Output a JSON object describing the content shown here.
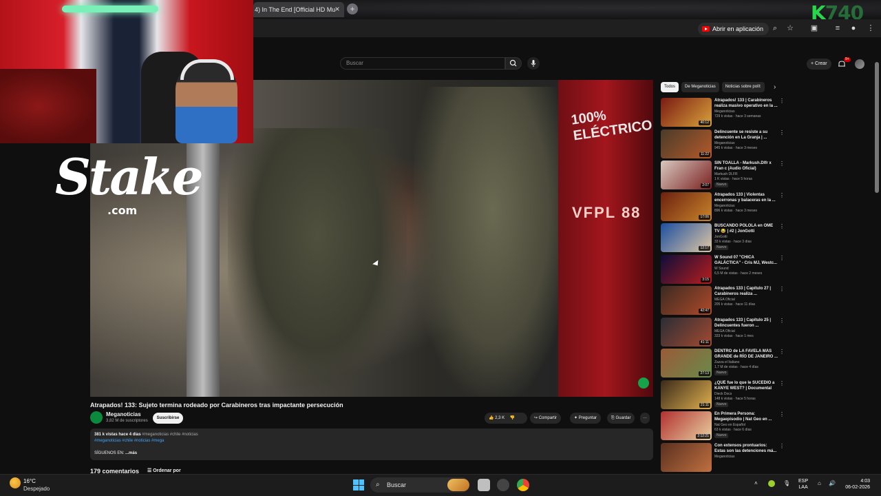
{
  "browser": {
    "tab_title": "4) In The End [Official HD Mu",
    "tab_close": "×",
    "new_tab": "+",
    "overlay_logo_letter": "K",
    "overlay_logo_text": "740",
    "open_in_app": "Abrir en aplicación"
  },
  "header": {
    "search_placeholder": "Buscar",
    "create_label": "+ Crear",
    "notifications_badge": "9+"
  },
  "video": {
    "title": "Atrapados! 133: Sujeto termina rodeado por Carabineros tras impactante persecución",
    "bus_text": "100% ELÉCTRICO",
    "bus_plate": "VFPL 88"
  },
  "sponsor": {
    "word": "Stake",
    "domain": ".com"
  },
  "channel": {
    "name": "Meganoticias",
    "subscribers": "3,82 M de suscriptores",
    "subscribe_label": "Suscribirse"
  },
  "actions": {
    "likes": "2,3 K",
    "share": "Compartir",
    "ask": "Preguntar",
    "save": "Guardar",
    "more": "···"
  },
  "description": {
    "stats": "381 k vistas  hace 4 días",
    "tags_line1": "#meganoticias #chile #noticias",
    "tags_line2": "#meganoticias #chile #noticias #mega",
    "follow": "SÍGUENOS EN:",
    "more": "...más"
  },
  "comments": {
    "count": "179 comentarios",
    "sort": "Ordenar por"
  },
  "sidebar": {
    "chips": [
      "Todos",
      "De Meganoticias",
      "Noticias sobre polít"
    ],
    "recommendations": [
      {
        "title": "Atrapados! 133 | Carabineros realiza masivo operativo en la ...",
        "channel": "Meganoticias",
        "meta": "729 k vistas · hace 3 semanas",
        "duration": "40:12",
        "badge": "",
        "colors": [
          "#7a1a14",
          "#d9a23a"
        ]
      },
      {
        "title": "Delincuente se resiste a su detención en La Granja | ...",
        "channel": "Meganoticias",
        "meta": "945 k vistas · hace 3 meses",
        "duration": "11:22",
        "badge": "",
        "colors": [
          "#4a3b2a",
          "#b45a2a"
        ]
      },
      {
        "title": "SIN TOALLA - Markush.Dlfr x Fran c (Audio Oficial)",
        "channel": "Markush DLFR",
        "meta": "1 K vistas · hace 5 horas",
        "duration": "2:07",
        "badge": "Nuevo",
        "colors": [
          "#d8c9c0",
          "#7a2020"
        ]
      },
      {
        "title": "Atrapados 133 | Violentas encerronas y balaceras en la ...",
        "channel": "Meganoticias",
        "meta": "896 k vistas · hace 3 meses",
        "duration": "17:06",
        "badge": "",
        "colors": [
          "#6b2010",
          "#c9852a"
        ]
      },
      {
        "title": "BUSCANDO POLOLA en OME TV 😂 | #2 | JonGotti",
        "channel": "JonGotti",
        "meta": "33 k vistas · hace 3 días",
        "duration": "12:17",
        "badge": "Nuevo",
        "colors": [
          "#1c4fa0",
          "#e0c7a4"
        ]
      },
      {
        "title": "W Sound 07 \"CHICA GALÁCTICA\" - Cris MJ, Westc...",
        "channel": "W Sound",
        "meta": "6,5 M de vistas · hace 2 meses",
        "duration": "3:15",
        "badge": "",
        "colors": [
          "#0d0d3a",
          "#b81e1e"
        ]
      },
      {
        "title": "Atrapados 133 | Capítulo 27 | Carabineros realiza ...",
        "channel": "MEGA Oficial",
        "meta": "205 k vistas · hace 11 días",
        "duration": "42:47",
        "badge": "",
        "colors": [
          "#3a2a22",
          "#b04a2a"
        ]
      },
      {
        "title": "Atrapados 133 | Capítulo 25 | Delincuentes fueron ...",
        "channel": "MEGA Oficial",
        "meta": "333 k vistas · hace 1 mes",
        "duration": "41:11",
        "badge": "",
        "colors": [
          "#2a2d36",
          "#a34a30"
        ]
      },
      {
        "title": "DENTRO de LA FAVELA MÁS GRANDE de RÍO DE JANEIRO ...",
        "channel": "Zazza el Italiano",
        "meta": "1,7 M de vistas · hace 4 días",
        "duration": "27:13",
        "badge": "Nuevo",
        "colors": [
          "#9a5a38",
          "#6a8a4a"
        ]
      },
      {
        "title": "¿QUÉ fue lo que le SUCEDIÓ a KANYE WEST? | Documental",
        "channel": "Dieck Docs",
        "meta": "148 k vistas · hace 5 horas",
        "duration": "21:11",
        "badge": "Nuevo",
        "colors": [
          "#3a2a1a",
          "#e0b050"
        ]
      },
      {
        "title": "En Primera Persona: Megaepisodio | Nat Geo en ...",
        "channel": "Nat Geo en Español",
        "meta": "63 k vistas · hace 6 días",
        "duration": "2:12:21",
        "badge": "Nuevo",
        "colors": [
          "#b23030",
          "#e8d0a0"
        ]
      },
      {
        "title": "Con extensos prontuarios: Estas son las detenciones má...",
        "channel": "Meganoticias",
        "meta": "",
        "duration": "",
        "badge": "",
        "colors": [
          "#5a3020",
          "#c07040"
        ]
      }
    ]
  },
  "taskbar": {
    "temp": "16°C",
    "weather": "Despejado",
    "search": "Buscar",
    "lang_line1": "ESP",
    "lang_line2": "LAA",
    "time": "4:03",
    "date": "06-02-2026"
  }
}
